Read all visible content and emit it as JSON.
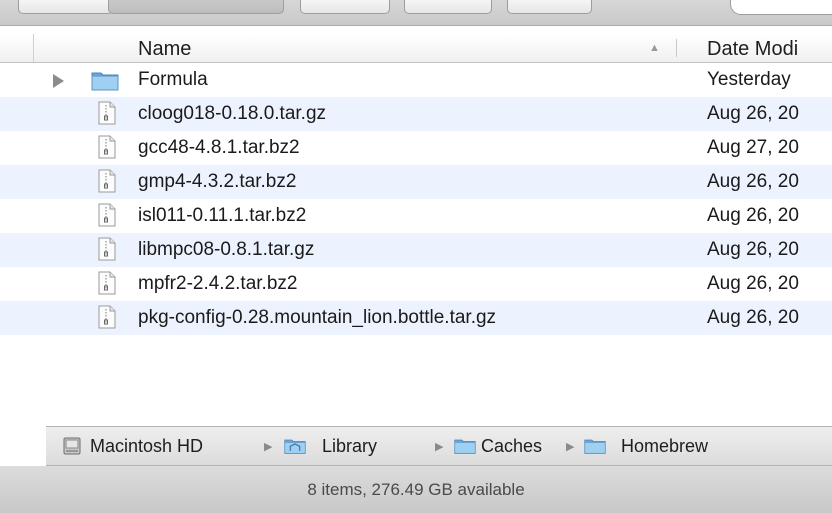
{
  "columns": {
    "name": "Name",
    "date": "Date Modi"
  },
  "rows": [
    {
      "name": "Formula",
      "date": "Yesterday",
      "kind": "folder",
      "icon": "folder-icon",
      "expandable": true
    },
    {
      "name": "cloog018-0.18.0.tar.gz",
      "date": "Aug 26, 20",
      "kind": "file",
      "icon": "document-icon"
    },
    {
      "name": "gcc48-4.8.1.tar.bz2",
      "date": "Aug 27, 20",
      "kind": "file",
      "icon": "document-icon"
    },
    {
      "name": "gmp4-4.3.2.tar.bz2",
      "date": "Aug 26, 20",
      "kind": "file",
      "icon": "document-icon"
    },
    {
      "name": "isl011-0.11.1.tar.bz2",
      "date": "Aug 26, 20",
      "kind": "file",
      "icon": "document-icon"
    },
    {
      "name": "libmpc08-0.8.1.tar.gz",
      "date": "Aug 26, 20",
      "kind": "file",
      "icon": "document-icon"
    },
    {
      "name": "mpfr2-2.4.2.tar.bz2",
      "date": "Aug 26, 20",
      "kind": "file",
      "icon": "document-icon"
    },
    {
      "name": "pkg-config-0.28.mountain_lion.bottle.tar.gz",
      "date": "Aug 26, 20",
      "kind": "file",
      "icon": "document-icon"
    }
  ],
  "path": [
    {
      "label": "Macintosh HD",
      "icon": "hard-drive-icon"
    },
    {
      "label": "Library",
      "icon": "library-folder-icon"
    },
    {
      "label": "Caches",
      "icon": "folder-icon"
    },
    {
      "label": "Homebrew",
      "icon": "folder-icon"
    }
  ],
  "status": "8 items, 276.49 GB available",
  "colors": {
    "row_alt": "#edf3fe",
    "folder_blue": "#7db9e8"
  }
}
